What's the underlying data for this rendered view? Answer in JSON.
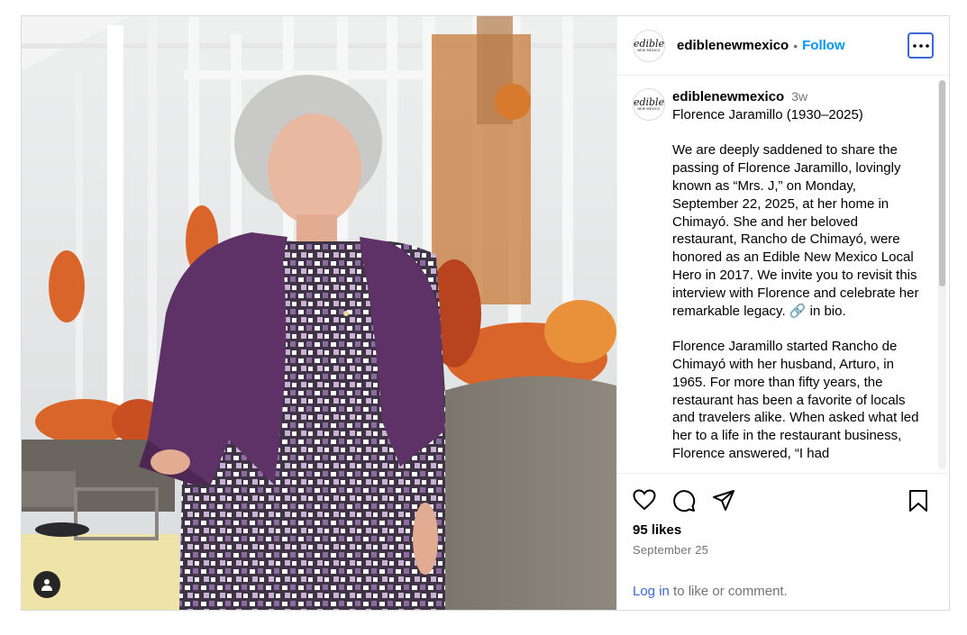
{
  "post": {
    "username": "ediblenewmexico",
    "avatar_text_top": "edible",
    "avatar_text_bottom": "NEW MEXICO",
    "follow_label": "Follow",
    "separator": "•",
    "caption": {
      "username": "ediblenewmexico",
      "time_ago": "3w",
      "paragraphs": [
        "Florence Jaramillo (1930–2025)",
        "We are deeply saddened to share the passing of Florence Jaramillo, lovingly known as “Mrs. J,” on Monday, September 22, 2025, at her home in Chimayó. She and her beloved restaurant, Rancho de Chimayó, were honored as an Edible New Mexico Local Hero in 2017. We invite you to revisit this interview with Florence and celebrate her remarkable legacy. 🔗 in bio.",
        "Florence Jaramillo started Rancho de Chimayó with her husband, Arturo, in 1965. For more than fifty years, the restaurant has been a favorite of locals and travelers alike. When asked what led her to a life in the restaurant business, Florence answered, “I had"
      ]
    },
    "likes": "95 likes",
    "date": "September 25",
    "login_link": "Log in",
    "login_suffix": " to like or comment.",
    "icons": [
      "more-options-icon",
      "heart-icon",
      "comment-icon",
      "share-icon",
      "save-icon",
      "user-tag-icon"
    ]
  },
  "colors": {
    "link_blue": "#0095f6",
    "muted_text": "#737373",
    "border": "#dbdbdb"
  }
}
